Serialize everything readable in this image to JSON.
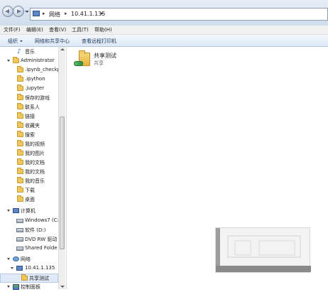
{
  "address": {
    "segments": [
      "网络",
      "10.41.1.135"
    ]
  },
  "menu": [
    "文件(F)",
    "编辑(E)",
    "查看(V)",
    "工具(T)",
    "帮助(H)"
  ],
  "commands": {
    "organize": "组织",
    "network_center": "网络和共享中心",
    "remote_printers": "查看远程打印机"
  },
  "nav": {
    "items": [
      {
        "label": "音乐",
        "icon": "music-note-icon"
      },
      {
        "label": "Administrator",
        "icon": "user-folder-icon"
      },
      {
        "label": ".ipynb_checkp",
        "icon": "folder-icon"
      },
      {
        "label": ".ipython",
        "icon": "folder-icon"
      },
      {
        "label": ".jupyter",
        "icon": "folder-icon"
      },
      {
        "label": "保存的游戏",
        "icon": "folder-icon"
      },
      {
        "label": "联系人",
        "icon": "folder-icon"
      },
      {
        "label": "链接",
        "icon": "folder-icon"
      },
      {
        "label": "收藏夹",
        "icon": "folder-icon"
      },
      {
        "label": "搜索",
        "icon": "folder-icon"
      },
      {
        "label": "我的视频",
        "icon": "folder-icon"
      },
      {
        "label": "我的图片",
        "icon": "folder-icon"
      },
      {
        "label": "我的文档",
        "icon": "folder-icon"
      },
      {
        "label": "我的文档",
        "icon": "folder-icon"
      },
      {
        "label": "我的音乐",
        "icon": "folder-icon"
      },
      {
        "label": "下载",
        "icon": "folder-icon"
      },
      {
        "label": "桌面",
        "icon": "folder-icon"
      },
      {
        "label": "计算机",
        "icon": "computer-icon"
      },
      {
        "label": "Windows7 (C:",
        "icon": "drive-icon"
      },
      {
        "label": "软件 (D:)",
        "icon": "drive-icon"
      },
      {
        "label": "DVD RW 驱动",
        "icon": "drive-icon"
      },
      {
        "label": "Shared Folde",
        "icon": "drive-icon"
      },
      {
        "label": "网络",
        "icon": "network-icon"
      },
      {
        "label": "10.41.1.135",
        "icon": "computer-icon"
      },
      {
        "label": "共享测试",
        "icon": "folder-icon"
      },
      {
        "label": "控制面板",
        "icon": "control-panel-icon"
      }
    ]
  },
  "content": {
    "share_name": "共享测试",
    "share_type": "共享"
  },
  "colors": {
    "accent": "#1e3b63",
    "selection": "#dfe9f7",
    "folder": "#efc75a"
  }
}
